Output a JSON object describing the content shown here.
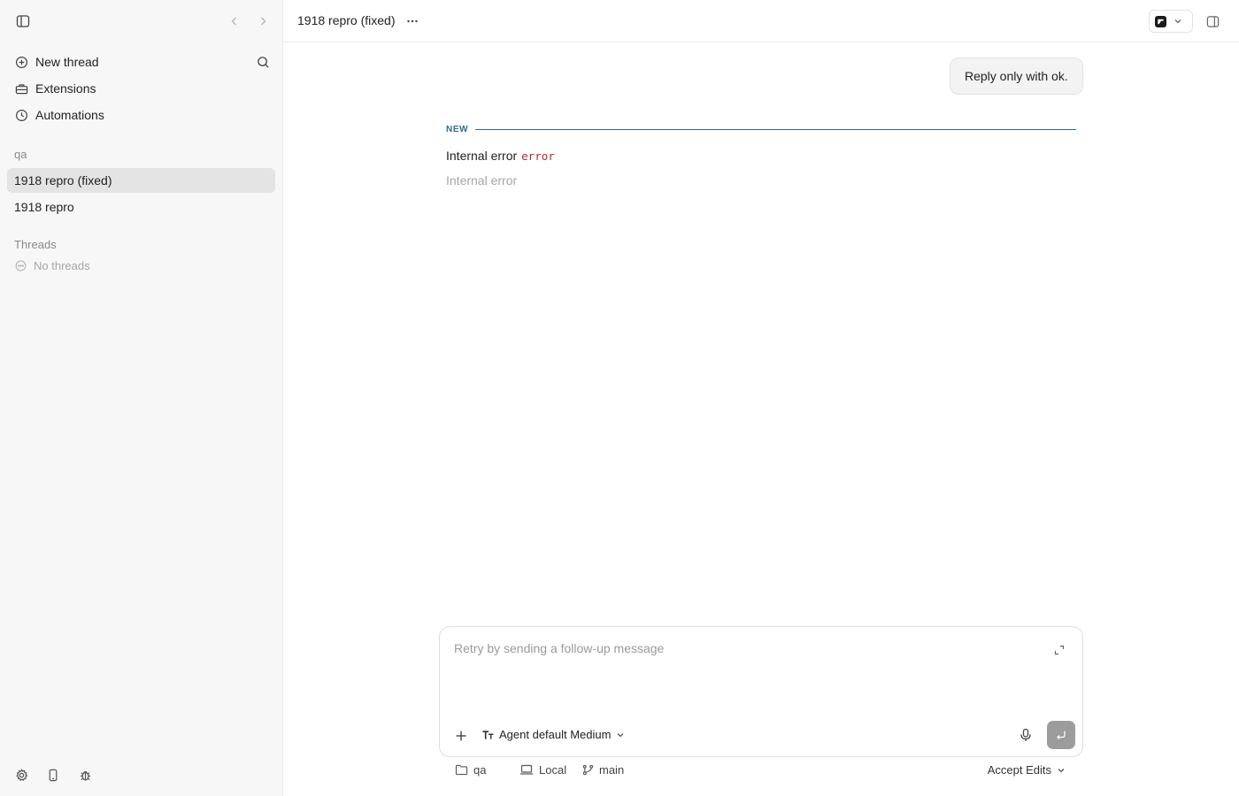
{
  "sidebar": {
    "nav": [
      {
        "label": "New thread",
        "icon": "plus-circle-icon"
      },
      {
        "label": "Extensions",
        "icon": "toolbox-icon"
      },
      {
        "label": "Automations",
        "icon": "clock-icon"
      }
    ],
    "project_section": "qa",
    "projects": [
      {
        "label": "1918 repro (fixed)",
        "active": true
      },
      {
        "label": "1918 repro",
        "active": false
      }
    ],
    "threads_section": "Threads",
    "no_threads": "No threads"
  },
  "header": {
    "title": "1918 repro (fixed)",
    "more": "···"
  },
  "conversation": {
    "user_message": "Reply only with ok.",
    "divider_label": "NEW",
    "error_text": "Internal error",
    "error_code": "error",
    "error_detail": "Internal error"
  },
  "composer": {
    "placeholder": "Retry by sending a follow-up message",
    "value": "",
    "agent_label": "Agent default Medium"
  },
  "footer": {
    "folder": "qa",
    "env": "Local",
    "branch": "main",
    "mode": "Accept Edits"
  },
  "colors": {
    "accent_divider": "#2f6a8f",
    "error_code": "#b22a2a",
    "sidebar_bg": "#f7f7f7",
    "active_item": "#e4e4e4",
    "send_button": "#9c9c9c"
  }
}
